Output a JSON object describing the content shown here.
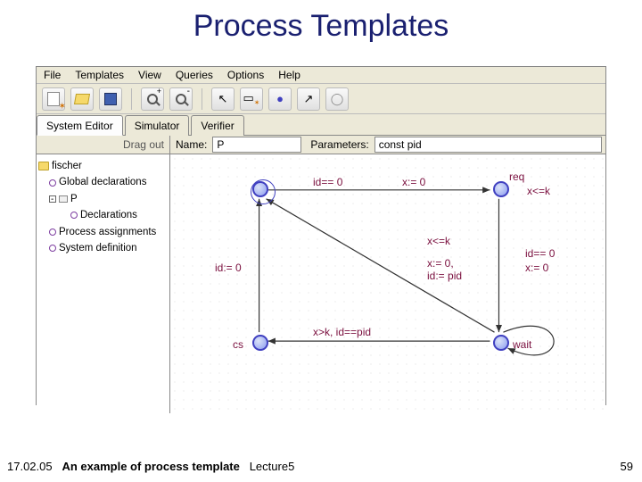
{
  "slide": {
    "title": "Process Templates",
    "footer_date": "17.02.05",
    "footer_caption": "An example of process template",
    "footer_lecture": "Lecture5",
    "page_number": "59"
  },
  "menus": [
    "File",
    "Templates",
    "View",
    "Queries",
    "Options",
    "Help"
  ],
  "tabs": {
    "editor": "System Editor",
    "simulator": "Simulator",
    "verifier": "Verifier"
  },
  "midbar": {
    "dragout": "Drag out",
    "name_label": "Name:",
    "name_value": "P",
    "param_label": "Parameters:",
    "param_value": "const pid"
  },
  "tree": {
    "root": "fischer",
    "global_decl": "Global declarations",
    "template": "P",
    "local_decl": "Declarations",
    "proc_assign": "Process assignments",
    "sys_def": "System definition"
  },
  "automaton": {
    "locations": {
      "idle": "",
      "req": "req",
      "wait": "wait",
      "cs": "cs"
    },
    "invariants": {
      "req_inv": "x<=k"
    },
    "edges": {
      "idle_req_guard": "id== 0",
      "idle_req_update": "x:= 0",
      "req_wait_guard": "x<=k",
      "req_wait_update": "x:= 0,\nid:= pid",
      "wait_cs_guard": "x>k, id==pid",
      "wait_idle_guard": "id== 0",
      "wait_idle_update": "x:= 0",
      "cs_idle_update": "id:= 0"
    }
  }
}
